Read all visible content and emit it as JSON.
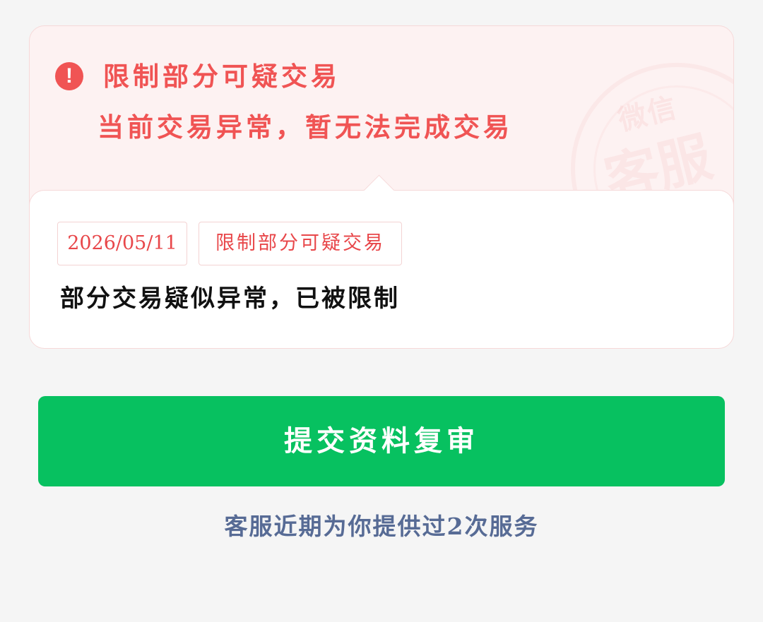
{
  "notice": {
    "icon": "alert-circle-icon",
    "title": "限制部分可疑交易",
    "subtitle": "当前交易异常，暂无法完成交易",
    "stamp_text_top": "微信",
    "stamp_text_big": "客服",
    "colors": {
      "alert_red": "#f05454",
      "card_bg": "#fdf2f2"
    }
  },
  "detail": {
    "date_tag": "2026/05/11",
    "type_tag": "限制部分可疑交易",
    "description": "部分交易疑似异常，已被限制"
  },
  "actions": {
    "submit_label": "提交资料复审",
    "submit_color": "#07c160"
  },
  "footer": {
    "service_note": "客服近期为你提供过2次服务",
    "link_color": "#576b95"
  }
}
